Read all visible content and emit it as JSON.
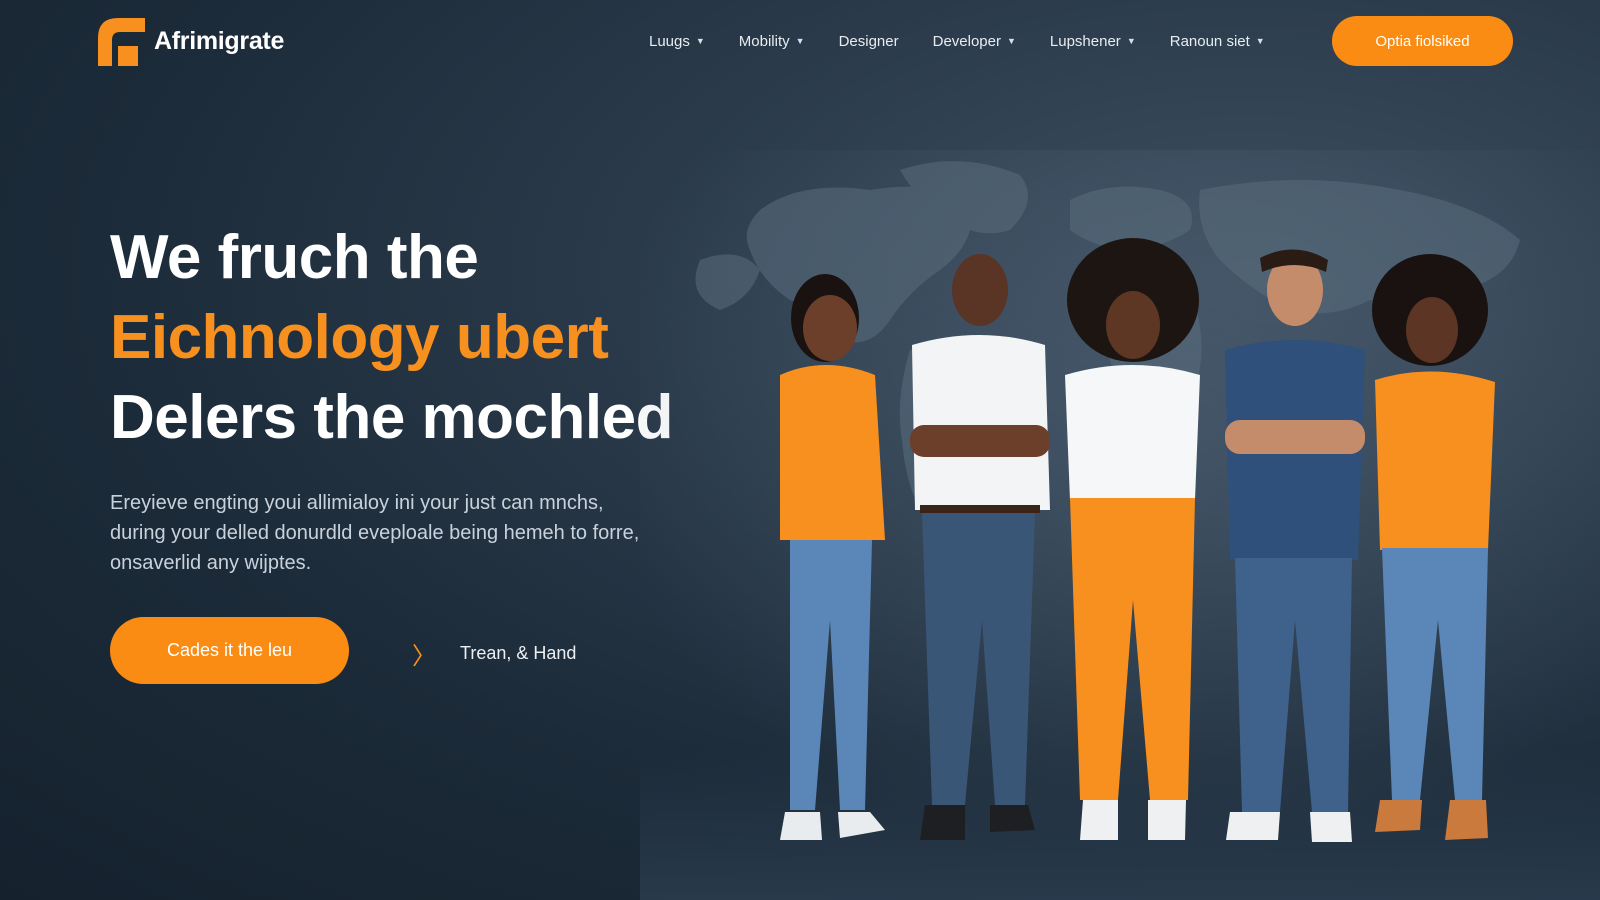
{
  "brand": {
    "name": "Afrimigrate",
    "accent": "#fb8c13"
  },
  "nav": {
    "items": [
      {
        "label": "Luugs",
        "has_dropdown": true
      },
      {
        "label": "Mobility",
        "has_dropdown": true
      },
      {
        "label": "Designer",
        "has_dropdown": false
      },
      {
        "label": "Developer",
        "has_dropdown": true
      },
      {
        "label": "Lupshener",
        "has_dropdown": true
      },
      {
        "label": "Ranoun siet",
        "has_dropdown": true
      }
    ],
    "cta_label": "Optia fiolsiked"
  },
  "hero": {
    "title_line1": "We fruch the",
    "title_line2": "Eichnology ubert",
    "title_line3": "Delers the mochled",
    "desc_line1": "Ereyieve engting youi allimialoy ini your just can mnchs,",
    "desc_line2": "during your delled donurdld eveploale being hemeh to forre,",
    "desc_line3": "onsaverlid any wijptes.",
    "primary_cta": "Cades it the leu",
    "secondary_cta": "Trean, & Hand"
  },
  "icons": {
    "logo": "brand-logo-icon",
    "caret": "chevron-down-icon",
    "secondary": "chevron-right-icon"
  }
}
